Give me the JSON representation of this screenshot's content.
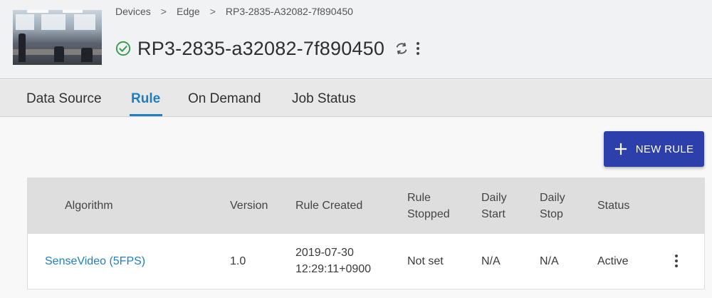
{
  "breadcrumb": [
    {
      "label": "Devices"
    },
    {
      "label": "Edge"
    },
    {
      "label": "RP3-2835-A32082-7f890450"
    }
  ],
  "breadcrumb_separator": ">",
  "device": {
    "title": "RP3-2835-a32082-7f890450",
    "status_icon": "check-circle-icon",
    "status_color": "#2e9b4a"
  },
  "tabs": [
    {
      "label": "Data Source",
      "active": false
    },
    {
      "label": "Rule",
      "active": true
    },
    {
      "label": "On Demand",
      "active": false
    },
    {
      "label": "Job Status",
      "active": false
    }
  ],
  "toolbar": {
    "new_rule_label": "NEW RULE",
    "button_color": "#2d3faa"
  },
  "table": {
    "headers": {
      "algorithm": "Algorithm",
      "version": "Version",
      "rule_created": "Rule Created",
      "rule_stopped_1": "Rule",
      "rule_stopped_2": "Stopped",
      "daily_start_1": "Daily",
      "daily_start_2": "Start",
      "daily_stop_1": "Daily",
      "daily_stop_2": "Stop",
      "status": "Status"
    },
    "rows": [
      {
        "algorithm": "SenseVideo (5FPS)",
        "version": "1.0",
        "rule_created_1": "2019-07-30",
        "rule_created_2": "12:29:11+0900",
        "rule_stopped": "Not set",
        "daily_start": "N/A",
        "daily_stop": "N/A",
        "status": "Active"
      }
    ]
  },
  "accent_color": "#1f7fc0"
}
